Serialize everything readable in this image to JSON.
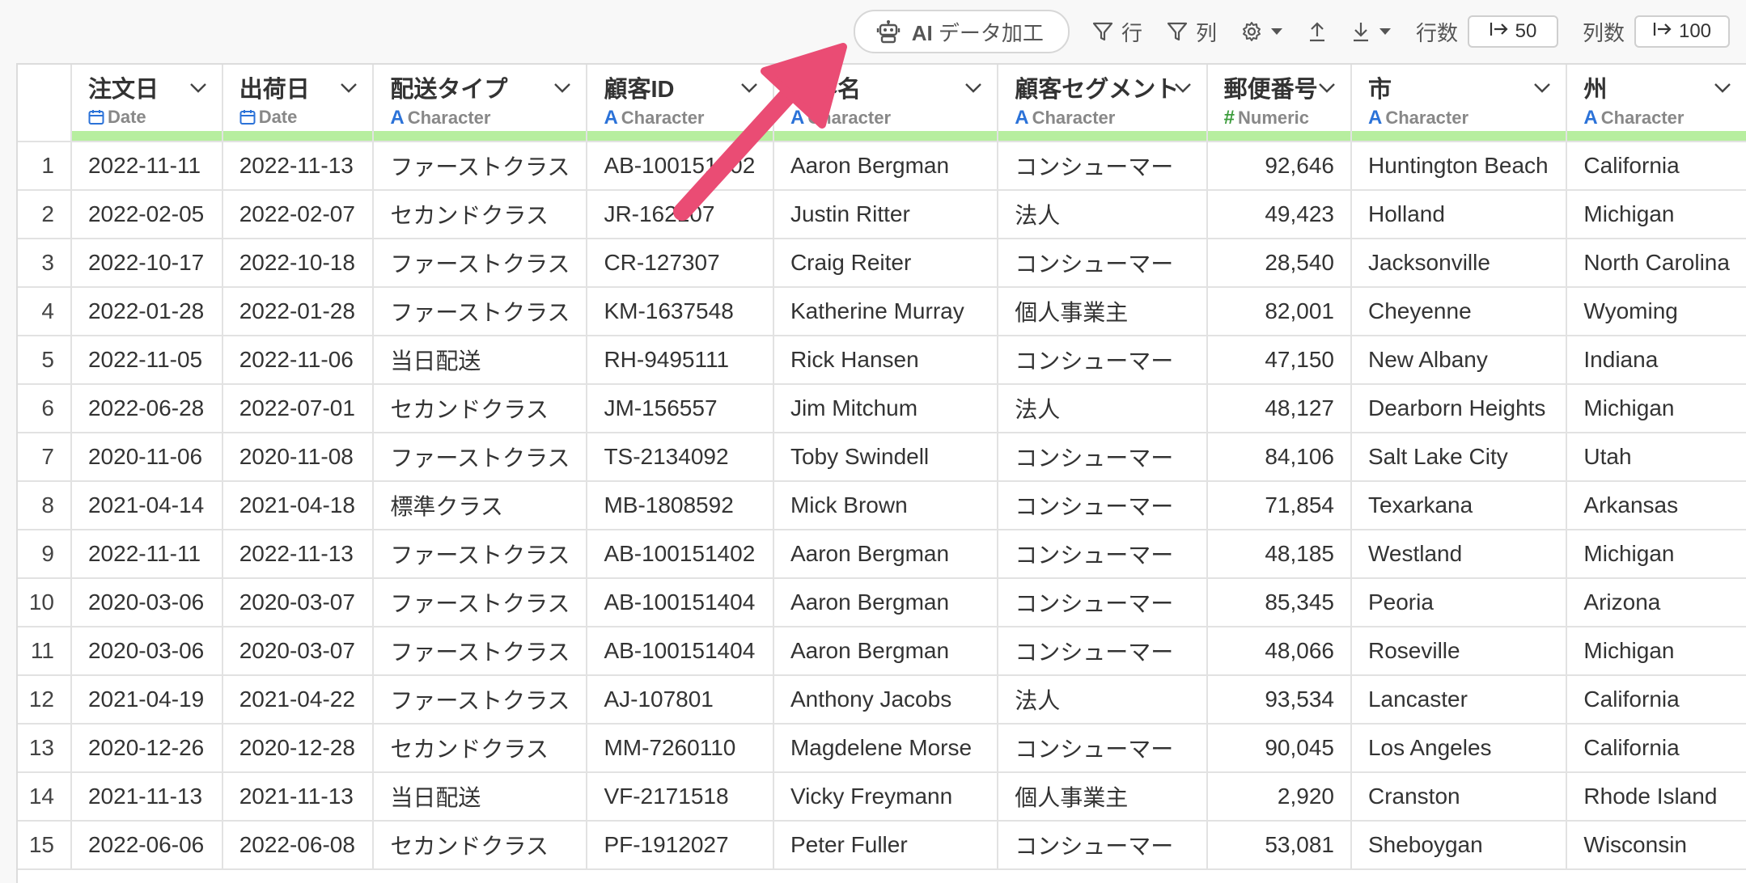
{
  "toolbar": {
    "ai_button_ai": "AI",
    "ai_button_label": "データ加工",
    "filter_row_label": "行",
    "filter_col_label": "列",
    "row_count_label": "行数",
    "row_count_value": "50",
    "col_count_label": "列数",
    "col_count_value": "100"
  },
  "columns": [
    {
      "name": "注文日",
      "type": "Date",
      "icon": "calendar-icon"
    },
    {
      "name": "出荷日",
      "type": "Date",
      "icon": "calendar-icon"
    },
    {
      "name": "配送タイプ",
      "type": "Character",
      "icon": "character-type-icon"
    },
    {
      "name": "顧客ID",
      "type": "Character",
      "icon": "character-type-icon"
    },
    {
      "name": "顧客名",
      "type": "Character",
      "icon": "character-type-icon"
    },
    {
      "name": "顧客セグメント",
      "type": "Character",
      "icon": "character-type-icon"
    },
    {
      "name": "郵便番号",
      "type": "Numeric",
      "icon": "numeric-type-icon"
    },
    {
      "name": "市",
      "type": "Character",
      "icon": "character-type-icon"
    },
    {
      "name": "州",
      "type": "Character",
      "icon": "character-type-icon"
    }
  ],
  "rows": [
    [
      "1",
      "2022-11-11",
      "2022-11-13",
      "ファーストクラス",
      "AB-100151402",
      "Aaron Bergman",
      "コンシューマー",
      "92,646",
      "Huntington Beach",
      "California"
    ],
    [
      "2",
      "2022-02-05",
      "2022-02-07",
      "セカンドクラス",
      "JR-162107",
      "Justin Ritter",
      "法人",
      "49,423",
      "Holland",
      "Michigan"
    ],
    [
      "3",
      "2022-10-17",
      "2022-10-18",
      "ファーストクラス",
      "CR-127307",
      "Craig Reiter",
      "コンシューマー",
      "28,540",
      "Jacksonville",
      "North Carolina"
    ],
    [
      "4",
      "2022-01-28",
      "2022-01-28",
      "ファーストクラス",
      "KM-1637548",
      "Katherine Murray",
      "個人事業主",
      "82,001",
      "Cheyenne",
      "Wyoming"
    ],
    [
      "5",
      "2022-11-05",
      "2022-11-06",
      "当日配送",
      "RH-9495111",
      "Rick Hansen",
      "コンシューマー",
      "47,150",
      "New Albany",
      "Indiana"
    ],
    [
      "6",
      "2022-06-28",
      "2022-07-01",
      "セカンドクラス",
      "JM-156557",
      "Jim Mitchum",
      "法人",
      "48,127",
      "Dearborn Heights",
      "Michigan"
    ],
    [
      "7",
      "2020-11-06",
      "2020-11-08",
      "ファーストクラス",
      "TS-2134092",
      "Toby Swindell",
      "コンシューマー",
      "84,106",
      "Salt Lake City",
      "Utah"
    ],
    [
      "8",
      "2021-04-14",
      "2021-04-18",
      "標準クラス",
      "MB-1808592",
      "Mick Brown",
      "コンシューマー",
      "71,854",
      "Texarkana",
      "Arkansas"
    ],
    [
      "9",
      "2022-11-11",
      "2022-11-13",
      "ファーストクラス",
      "AB-100151402",
      "Aaron Bergman",
      "コンシューマー",
      "48,185",
      "Westland",
      "Michigan"
    ],
    [
      "10",
      "2020-03-06",
      "2020-03-07",
      "ファーストクラス",
      "AB-100151404",
      "Aaron Bergman",
      "コンシューマー",
      "85,345",
      "Peoria",
      "Arizona"
    ],
    [
      "11",
      "2020-03-06",
      "2020-03-07",
      "ファーストクラス",
      "AB-100151404",
      "Aaron Bergman",
      "コンシューマー",
      "48,066",
      "Roseville",
      "Michigan"
    ],
    [
      "12",
      "2021-04-19",
      "2021-04-22",
      "ファーストクラス",
      "AJ-107801",
      "Anthony Jacobs",
      "法人",
      "93,534",
      "Lancaster",
      "California"
    ],
    [
      "13",
      "2020-12-26",
      "2020-12-28",
      "セカンドクラス",
      "MM-7260110",
      "Magdelene Morse",
      "コンシューマー",
      "90,045",
      "Los Angeles",
      "California"
    ],
    [
      "14",
      "2021-11-13",
      "2021-11-13",
      "当日配送",
      "VF-2171518",
      "Vicky Freymann",
      "個人事業主",
      "2,920",
      "Cranston",
      "Rhode Island"
    ],
    [
      "15",
      "2022-06-06",
      "2022-06-08",
      "セカンドクラス",
      "PF-1912027",
      "Peter Fuller",
      "コンシューマー",
      "53,081",
      "Sheboygan",
      "Wisconsin"
    ]
  ]
}
